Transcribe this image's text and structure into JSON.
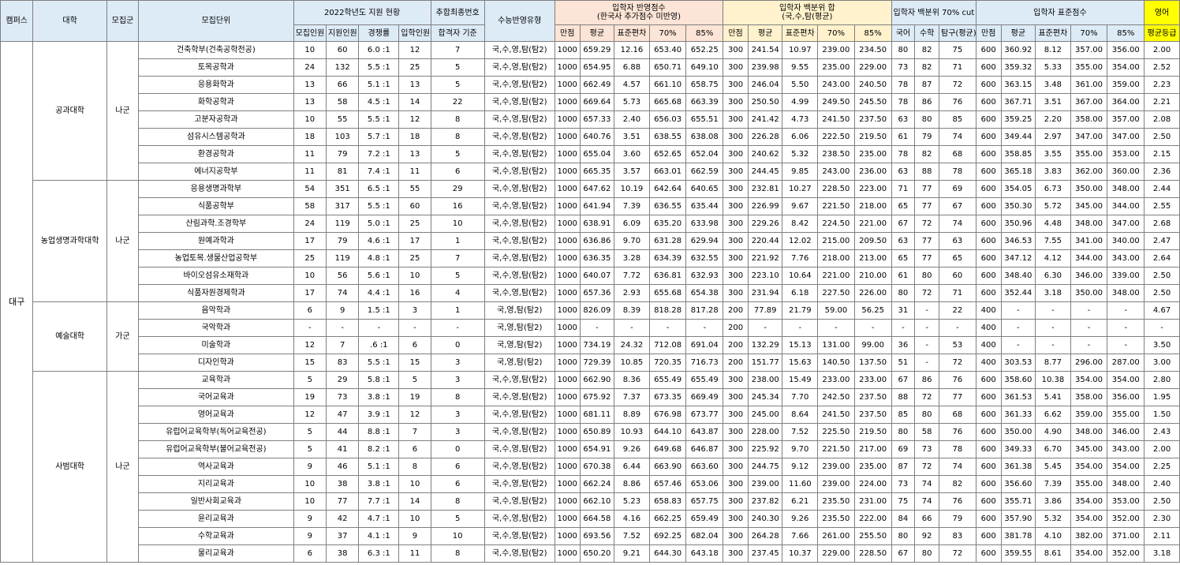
{
  "colors": {
    "header_blue": "#ddebf7",
    "header_orange": "#fce4d6",
    "header_yellow": "#fff2cc",
    "header_english": "#ffff00",
    "grid": "#7f7f7f"
  },
  "headers": {
    "campus": "캠퍼스",
    "college": "대학",
    "group": "모집군",
    "unit": "모집단위",
    "status_2022": "2022학년도 지원 현황",
    "final_no": "추합최종번호",
    "suneung_type": "수능반영유형",
    "reflected": "입학자 반영점수\n(한국사 추가점수 미반영)",
    "percentile_sum": "입학자 백분위 합\n(국,수,탐(평균)",
    "percentile_cut": "입학자 백분위 70% cut",
    "std_score": "입학자 표준점수",
    "english": "영어",
    "quota": "모집인원",
    "applicants": "지원인원",
    "competition": "경쟁률",
    "admitted": "입학인원",
    "pass_basis": "합격자 기준",
    "full": "만점",
    "avg": "평균",
    "stdev": "표준편차",
    "p70": "70%",
    "p85": "85%",
    "kor": "국어",
    "math": "수학",
    "inquiry": "탐구(평균)",
    "eng_grade": "평균등급"
  },
  "campus": "대구",
  "colleges": [
    {
      "name": "공과대학",
      "group": "나군",
      "rows": [
        [
          "건축학부(건축공학전공)",
          "10",
          "60",
          "6.0 :1",
          "12",
          "7",
          "국,수,영,탐(탐2)",
          "1000",
          "659.29",
          "12.16",
          "653.40",
          "652.25",
          "300",
          "241.54",
          "10.97",
          "239.00",
          "234.50",
          "80",
          "82",
          "75",
          "600",
          "360.92",
          "8.12",
          "357.00",
          "356.00",
          "2.00"
        ],
        [
          "토목공학과",
          "24",
          "132",
          "5.5 :1",
          "25",
          "5",
          "국,수,영,탐(탐2)",
          "1000",
          "654.95",
          "6.88",
          "650.71",
          "649.10",
          "300",
          "239.98",
          "9.55",
          "235.00",
          "229.00",
          "73",
          "82",
          "71",
          "600",
          "359.32",
          "5.33",
          "355.00",
          "354.00",
          "2.52"
        ],
        [
          "응용화학과",
          "13",
          "66",
          "5.1 :1",
          "13",
          "5",
          "국,수,영,탐(탐2)",
          "1000",
          "662.49",
          "4.57",
          "661.10",
          "658.75",
          "300",
          "246.04",
          "5.50",
          "243.00",
          "240.50",
          "78",
          "87",
          "72",
          "600",
          "363.15",
          "3.48",
          "361.00",
          "359.00",
          "2.23"
        ],
        [
          "화학공학과",
          "13",
          "58",
          "4.5 :1",
          "14",
          "22",
          "국,수,영,탐(탐2)",
          "1000",
          "669.64",
          "5.73",
          "665.68",
          "663.39",
          "300",
          "250.50",
          "4.99",
          "249.50",
          "245.50",
          "78",
          "86",
          "76",
          "600",
          "367.71",
          "3.51",
          "367.00",
          "364.00",
          "2.21"
        ],
        [
          "고분자공학과",
          "10",
          "55",
          "5.5 :1",
          "12",
          "8",
          "국,수,영,탐(탐2)",
          "1000",
          "657.33",
          "2.40",
          "656.03",
          "655.51",
          "300",
          "241.42",
          "4.73",
          "241.50",
          "237.50",
          "63",
          "80",
          "85",
          "600",
          "359.25",
          "2.20",
          "358.00",
          "357.00",
          "2.08"
        ],
        [
          "섬유시스템공학과",
          "18",
          "103",
          "5.7 :1",
          "18",
          "8",
          "국,수,영,탐(탐2)",
          "1000",
          "640.76",
          "3.51",
          "638.55",
          "638.08",
          "300",
          "226.28",
          "6.06",
          "222.50",
          "219.50",
          "61",
          "79",
          "74",
          "600",
          "349.44",
          "2.97",
          "347.00",
          "347.00",
          "2.50"
        ],
        [
          "환경공학과",
          "11",
          "79",
          "7.2 :1",
          "13",
          "5",
          "국,수,영,탐(탐2)",
          "1000",
          "655.04",
          "3.60",
          "652.65",
          "652.04",
          "300",
          "240.62",
          "5.32",
          "238.50",
          "235.00",
          "78",
          "82",
          "68",
          "600",
          "358.85",
          "3.55",
          "355.00",
          "353.00",
          "2.15"
        ],
        [
          "에너지공학부",
          "11",
          "81",
          "7.4 :1",
          "11",
          "6",
          "국,수,영,탐(탐2)",
          "1000",
          "665.35",
          "3.57",
          "663.01",
          "662.59",
          "300",
          "244.45",
          "9.85",
          "243.00",
          "236.00",
          "63",
          "88",
          "78",
          "600",
          "365.18",
          "3.83",
          "362.00",
          "360.00",
          "2.36"
        ]
      ]
    },
    {
      "name": "농업생명과학대학",
      "group": "나군",
      "rows": [
        [
          "응용생명과학부",
          "54",
          "351",
          "6.5 :1",
          "55",
          "29",
          "국,수,영,탐(탐2)",
          "1000",
          "647.62",
          "10.19",
          "642.64",
          "640.65",
          "300",
          "232.81",
          "10.27",
          "228.50",
          "223.00",
          "71",
          "77",
          "69",
          "600",
          "354.05",
          "6.73",
          "350.00",
          "348.00",
          "2.44"
        ],
        [
          "식품공학부",
          "58",
          "317",
          "5.5 :1",
          "60",
          "16",
          "국,수,영,탐(탐2)",
          "1000",
          "641.94",
          "7.39",
          "636.55",
          "635.44",
          "300",
          "226.99",
          "9.67",
          "221.50",
          "218.00",
          "65",
          "77",
          "67",
          "600",
          "350.30",
          "5.72",
          "345.00",
          "344.00",
          "2.55"
        ],
        [
          "산림과학.조경학부",
          "24",
          "119",
          "5.0 :1",
          "25",
          "10",
          "국,수,영,탐(탐2)",
          "1000",
          "638.91",
          "6.09",
          "635.20",
          "633.98",
          "300",
          "229.26",
          "8.42",
          "224.50",
          "221.00",
          "67",
          "72",
          "74",
          "600",
          "350.96",
          "4.48",
          "348.00",
          "347.00",
          "2.68"
        ],
        [
          "원예과학과",
          "17",
          "79",
          "4.6 :1",
          "17",
          "1",
          "국,수,영,탐(탐2)",
          "1000",
          "636.86",
          "9.70",
          "631.28",
          "629.94",
          "300",
          "220.44",
          "12.02",
          "215.00",
          "209.50",
          "63",
          "77",
          "63",
          "600",
          "346.53",
          "7.55",
          "341.00",
          "340.00",
          "2.47"
        ],
        [
          "농업토목.생물산업공학부",
          "25",
          "119",
          "4.8 :1",
          "25",
          "7",
          "국,수,영,탐(탐2)",
          "1000",
          "636.35",
          "3.28",
          "634.39",
          "632.55",
          "300",
          "221.92",
          "7.76",
          "218.00",
          "213.00",
          "65",
          "77",
          "65",
          "600",
          "347.12",
          "4.12",
          "344.00",
          "343.00",
          "2.64"
        ],
        [
          "바이오섬유소재학과",
          "10",
          "56",
          "5.6 :1",
          "10",
          "5",
          "국,수,영,탐(탐2)",
          "1000",
          "640.07",
          "7.72",
          "636.81",
          "632.93",
          "300",
          "223.10",
          "10.64",
          "221.00",
          "210.00",
          "61",
          "80",
          "60",
          "600",
          "348.40",
          "6.30",
          "346.00",
          "339.00",
          "2.50"
        ],
        [
          "식품자원경제학과",
          "17",
          "74",
          "4.4 :1",
          "16",
          "4",
          "국,수,영,탐(탐2)",
          "1000",
          "657.36",
          "2.93",
          "655.68",
          "654.38",
          "300",
          "231.94",
          "6.18",
          "227.50",
          "226.00",
          "80",
          "72",
          "71",
          "600",
          "352.44",
          "3.18",
          "350.00",
          "348.00",
          "2.50"
        ]
      ]
    },
    {
      "name": "예술대학",
      "group": "가군",
      "rows": [
        [
          "음악학과",
          "6",
          "9",
          "1.5 :1",
          "3",
          "1",
          "국,영,탐(탐2)",
          "1000",
          "826.09",
          "8.39",
          "818.28",
          "817.28",
          "200",
          "77.89",
          "21.79",
          "59.00",
          "56.25",
          "31",
          "-",
          "22",
          "400",
          "-",
          "-",
          "-",
          "-",
          "4.67"
        ],
        [
          "국악학과",
          "-",
          "-",
          "-",
          "-",
          "-",
          "국,영,탐(탐2)",
          "1000",
          "-",
          "-",
          "-",
          "-",
          "200",
          "-",
          "-",
          "-",
          "-",
          "-",
          "-",
          "-",
          "400",
          "-",
          "-",
          "-",
          "-",
          "-"
        ],
        [
          "미술학과",
          "12",
          "7",
          ".6 :1",
          "6",
          "0",
          "국,영,탐(탐2)",
          "1000",
          "734.19",
          "24.32",
          "712.08",
          "691.04",
          "200",
          "132.29",
          "15.13",
          "131.00",
          "99.00",
          "36",
          "-",
          "53",
          "400",
          "-",
          "-",
          "-",
          "-",
          "3.50"
        ],
        [
          "디자인학과",
          "15",
          "83",
          "5.5 :1",
          "15",
          "3",
          "국,영,탐(탐2)",
          "1000",
          "729.39",
          "10.85",
          "720.35",
          "716.73",
          "200",
          "151.77",
          "15.63",
          "140.50",
          "137.50",
          "51",
          "-",
          "72",
          "400",
          "303.53",
          "8.77",
          "296.00",
          "287.00",
          "3.00"
        ]
      ]
    },
    {
      "name": "사범대학",
      "group": "나군",
      "rows": [
        [
          "교육학과",
          "5",
          "29",
          "5.8 :1",
          "5",
          "3",
          "국,수,영,탐(탐2)",
          "1000",
          "662.90",
          "8.36",
          "655.49",
          "655.49",
          "300",
          "238.00",
          "15.49",
          "233.00",
          "233.00",
          "67",
          "86",
          "76",
          "600",
          "358.60",
          "10.38",
          "354.00",
          "354.00",
          "2.80"
        ],
        [
          "국어교육과",
          "19",
          "73",
          "3.8 :1",
          "19",
          "8",
          "국,수,영,탐(탐2)",
          "1000",
          "675.92",
          "7.37",
          "673.35",
          "669.49",
          "300",
          "245.34",
          "7.70",
          "242.50",
          "237.50",
          "88",
          "72",
          "77",
          "600",
          "361.53",
          "5.41",
          "358.00",
          "356.00",
          "1.95"
        ],
        [
          "영어교육과",
          "12",
          "47",
          "3.9 :1",
          "12",
          "3",
          "국,수,영,탐(탐2)",
          "1000",
          "681.11",
          "8.89",
          "676.98",
          "673.77",
          "300",
          "245.00",
          "8.64",
          "241.50",
          "237.50",
          "85",
          "80",
          "68",
          "600",
          "361.33",
          "6.62",
          "359.00",
          "355.00",
          "1.50"
        ],
        [
          "유럽어교육학부(독어교육전공)",
          "5",
          "44",
          "8.8 :1",
          "7",
          "3",
          "국,수,영,탐(탐2)",
          "1000",
          "650.89",
          "10.93",
          "644.10",
          "643.87",
          "300",
          "228.00",
          "7.52",
          "225.50",
          "219.50",
          "80",
          "58",
          "76",
          "600",
          "350.00",
          "4.90",
          "348.00",
          "346.00",
          "2.43"
        ],
        [
          "유럽어교육학부(불어교육전공)",
          "5",
          "41",
          "8.2 :1",
          "6",
          "0",
          "국,수,영,탐(탐2)",
          "1000",
          "654.91",
          "9.26",
          "649.68",
          "646.87",
          "300",
          "225.92",
          "9.70",
          "221.50",
          "217.00",
          "69",
          "73",
          "78",
          "600",
          "349.33",
          "6.70",
          "345.00",
          "343.00",
          "2.00"
        ],
        [
          "역사교육과",
          "9",
          "46",
          "5.1 :1",
          "8",
          "6",
          "국,수,영,탐(탐2)",
          "1000",
          "670.38",
          "6.44",
          "663.90",
          "663.60",
          "300",
          "244.75",
          "9.12",
          "239.00",
          "235.00",
          "87",
          "72",
          "74",
          "600",
          "361.38",
          "5.45",
          "354.00",
          "354.00",
          "2.25"
        ],
        [
          "지리교육과",
          "10",
          "38",
          "3.8 :1",
          "10",
          "6",
          "국,수,영,탐(탐2)",
          "1000",
          "662.24",
          "8.86",
          "657.46",
          "653.06",
          "300",
          "239.00",
          "11.60",
          "239.00",
          "224.00",
          "73",
          "74",
          "82",
          "600",
          "356.60",
          "7.39",
          "355.00",
          "348.00",
          "2.40"
        ],
        [
          "일반사회교육과",
          "10",
          "77",
          "7.7 :1",
          "14",
          "8",
          "국,수,영,탐(탐2)",
          "1000",
          "662.10",
          "5.23",
          "658.83",
          "657.75",
          "300",
          "237.82",
          "6.21",
          "235.50",
          "231.00",
          "75",
          "74",
          "76",
          "600",
          "355.71",
          "3.86",
          "354.00",
          "353.00",
          "2.50"
        ],
        [
          "윤리교육과",
          "9",
          "42",
          "4.7 :1",
          "10",
          "5",
          "국,수,영,탐(탐2)",
          "1000",
          "664.58",
          "4.16",
          "662.25",
          "659.49",
          "300",
          "240.30",
          "9.26",
          "235.50",
          "222.00",
          "84",
          "66",
          "79",
          "600",
          "357.90",
          "5.32",
          "354.00",
          "352.00",
          "2.30"
        ],
        [
          "수학교육과",
          "9",
          "37",
          "4.1 :1",
          "9",
          "10",
          "국,수,영,탐(탐2)",
          "1000",
          "693.56",
          "7.52",
          "692.25",
          "682.04",
          "300",
          "264.28",
          "7.66",
          "261.00",
          "255.50",
          "80",
          "92",
          "83",
          "600",
          "381.78",
          "4.10",
          "382.00",
          "371.00",
          "2.11"
        ],
        [
          "물리교육과",
          "6",
          "38",
          "6.3 :1",
          "11",
          "8",
          "국,수,영,탐(탐2)",
          "1000",
          "650.20",
          "9.21",
          "644.30",
          "643.18",
          "300",
          "237.45",
          "10.37",
          "229.00",
          "228.50",
          "67",
          "80",
          "72",
          "600",
          "359.55",
          "8.61",
          "354.00",
          "352.00",
          "3.18"
        ]
      ]
    }
  ]
}
